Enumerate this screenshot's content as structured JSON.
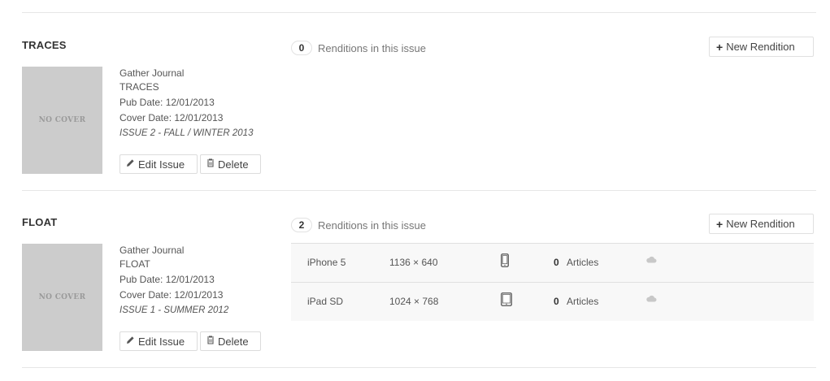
{
  "issues": [
    {
      "title": "TRACES",
      "cover_text": "NO COVER",
      "publication": "Gather Journal",
      "name": "TRACES",
      "pub_date": "Pub Date: 12/01/2013",
      "cover_date": "Cover Date: 12/01/2013",
      "label": "ISSUE 2 - FALL / WINTER 2013",
      "edit_label": "Edit Issue",
      "delete_label": "Delete",
      "rendition_count": "0",
      "rendition_text": "Renditions in this issue",
      "new_rendition_label": "New Rendition",
      "renditions": []
    },
    {
      "title": "FLOAT",
      "cover_text": "NO COVER",
      "publication": "Gather Journal",
      "name": "FLOAT",
      "pub_date": "Pub Date: 12/01/2013",
      "cover_date": "Cover Date: 12/01/2013",
      "label": "ISSUE 1 - SUMMER 2012",
      "edit_label": "Edit Issue",
      "delete_label": "Delete",
      "rendition_count": "2",
      "rendition_text": "Renditions in this issue",
      "new_rendition_label": "New Rendition",
      "renditions": [
        {
          "name": "iPhone 5",
          "dimensions": "1136 × 640",
          "device_icon": "phone-icon",
          "article_count": "0",
          "articles_label": "Articles",
          "status_icon": "cloud-icon"
        },
        {
          "name": "iPad SD",
          "dimensions": "1024 × 768",
          "device_icon": "tablet-icon",
          "article_count": "0",
          "articles_label": "Articles",
          "status_icon": "cloud-icon"
        }
      ]
    }
  ]
}
